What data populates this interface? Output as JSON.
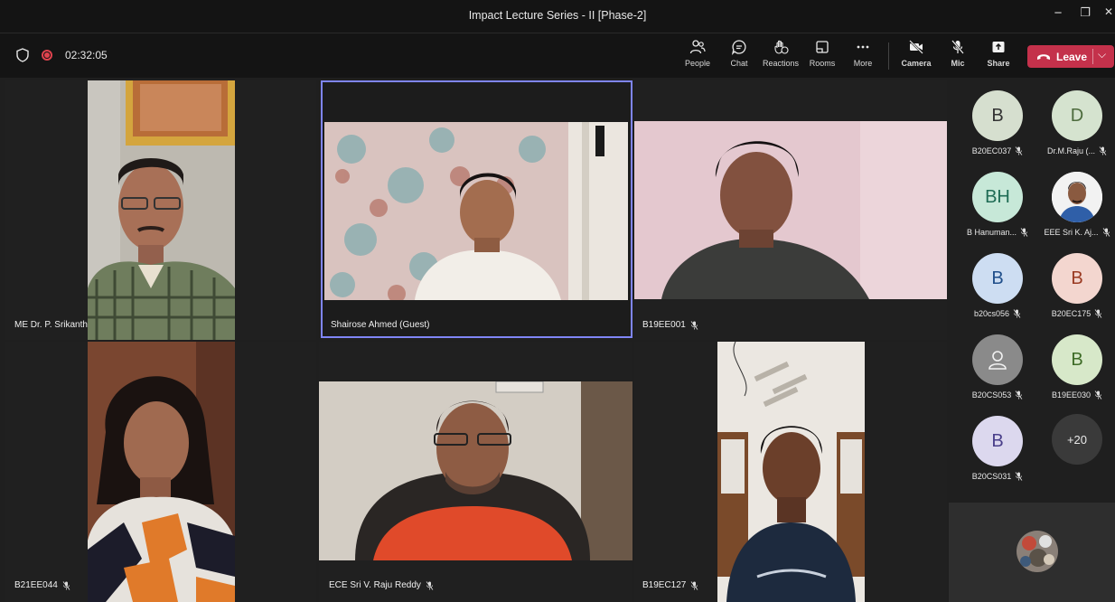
{
  "window": {
    "title": "Impact Lecture Series - II [Phase-2]",
    "controls": [
      "−",
      "❐",
      "✕"
    ]
  },
  "toolbar": {
    "timer": "02:32:05",
    "buttons": {
      "people": "People",
      "chat": "Chat",
      "reactions": "Reactions",
      "rooms": "Rooms",
      "more": "More",
      "camera": "Camera",
      "mic": "Mic",
      "share": "Share"
    },
    "leave_label": "Leave",
    "leave_color": "#c4314b"
  },
  "stage": {
    "tiles": [
      {
        "name": "ME Dr. P. Srikanth",
        "muted": false,
        "active_speaker": false
      },
      {
        "name": "Shairose Ahmed (Guest)",
        "muted": false,
        "active_speaker": true
      },
      {
        "name": "B19EE001",
        "muted": true,
        "active_speaker": false
      },
      {
        "name": "B21EE044",
        "muted": true,
        "active_speaker": false
      },
      {
        "name": "ECE Sri V. Raju Reddy",
        "muted": true,
        "active_speaker": false
      },
      {
        "name": "B19EC127",
        "muted": true,
        "active_speaker": false
      }
    ],
    "active_speaker_color": "#7f85f5"
  },
  "panel": {
    "participants": [
      {
        "initials": "B",
        "name": "B20EC037",
        "color": "#d6dfcf",
        "muted": true
      },
      {
        "initials": "D",
        "name": "Dr.M.Raju (...",
        "color": "#d5e3cf",
        "muted": true
      },
      {
        "initials": "BH",
        "name": "B Hanuman...",
        "color": "#c7e8d8",
        "muted": true
      },
      {
        "initials": "",
        "name": "EEE Sri K. Aj...",
        "color": "#ffffff",
        "muted": true
      },
      {
        "initials": "B",
        "name": "b20cs056",
        "color": "#cdddf2",
        "muted": true
      },
      {
        "initials": "B",
        "name": "B20EC175",
        "color": "#f3d6cf",
        "muted": true
      },
      {
        "initials": "",
        "name": "B20CS053",
        "color": "#8a8a8a",
        "muted": true
      },
      {
        "initials": "B",
        "name": "B19EE030",
        "color": "#d7e8c9",
        "muted": true
      },
      {
        "initials": "B",
        "name": "B20CS031",
        "color": "#dcd8ee",
        "muted": true
      }
    ],
    "overflow_count": "+20"
  }
}
